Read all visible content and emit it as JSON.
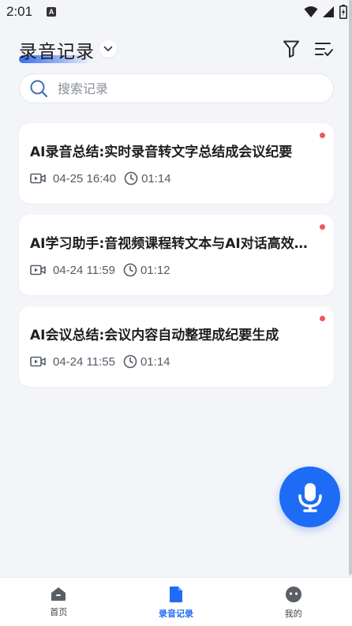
{
  "status_bar": {
    "time": "2:01",
    "notification_glyph": "A"
  },
  "header": {
    "title": "录音记录"
  },
  "search": {
    "placeholder": "搜索记录"
  },
  "recordings": [
    {
      "title": "AI录音总结:实时录音转文字总结成会议纪要",
      "date": "04-25 16:40",
      "duration": "01:14",
      "unread": true
    },
    {
      "title": "AI学习助手:音视频课程转文本与AI对话高效学习",
      "date": "04-24 11:59",
      "duration": "01:12",
      "unread": true
    },
    {
      "title": "AI会议总结:会议内容自动整理成纪要生成",
      "date": "04-24 11:55",
      "duration": "01:14",
      "unread": true
    }
  ],
  "bottom_nav": [
    {
      "label": "首页",
      "icon": "home-icon",
      "active": false
    },
    {
      "label": "录音记录",
      "icon": "document-icon",
      "active": true
    },
    {
      "label": "我的",
      "icon": "profile-icon",
      "active": false
    }
  ],
  "colors": {
    "accent": "#1e6cf5",
    "unread_dot": "#f0575b",
    "background": "#f3f5f9"
  }
}
